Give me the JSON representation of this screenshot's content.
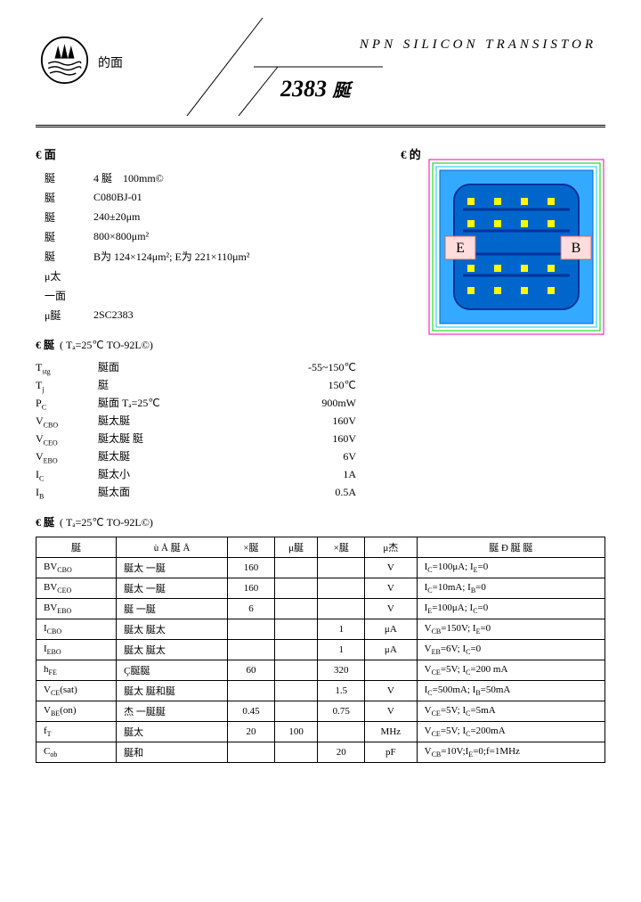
{
  "header": {
    "title": "NPN  SILICON  TRANSISTOR",
    "code": "2383",
    "code_suffix": "脠",
    "brand": "的面"
  },
  "sec1_title": "€  面",
  "sec2_title": "€  的",
  "specs": {
    "r0_lbl": "脠",
    "r0_val_a": "4 脠",
    "r0_val_b": "100mm©",
    "r1_lbl": "脠",
    "r1_val": "C080BJ-01",
    "r2_lbl": "脠",
    "r2_val": "240±20μm",
    "r3_lbl": "脠",
    "r3_val": "800×800μm²",
    "r4_lbl": "脠",
    "r4_val": "B为 124×124μm²; E为 221×110μm²",
    "r5_lbl": "μ太",
    "r6_lbl": "一面",
    "r7_lbl": "μ脠",
    "r7_val": "2SC2383"
  },
  "die_labels": {
    "e": "E",
    "b": "B"
  },
  "ratings": {
    "hdr_pre": "€  脠",
    "hdr_cond": "( Tₐ=25℃  TO-92L©)",
    "rows": [
      {
        "sym": "T_stg",
        "sym_sub": "stg",
        "sym_pre": "T",
        "mid": "脠面",
        "val": "-55~150℃"
      },
      {
        "sym_pre": "T",
        "sym_sub": "j",
        "mid": "脡",
        "val": "150℃"
      },
      {
        "sym_pre": "P",
        "sym_sub": "C",
        "mid": "脠面     Tₐ=25℃",
        "val": "900mW"
      },
      {
        "sym_pre": "V",
        "sym_sub": "CBO",
        "mid": "脠太脠",
        "val": "160V"
      },
      {
        "sym_pre": "V",
        "sym_sub": "CEO",
        "mid": "脠太脠     脡",
        "val": "160V"
      },
      {
        "sym_pre": "V",
        "sym_sub": "EBO",
        "mid": "脠太脠",
        "val": "6V"
      },
      {
        "sym_pre": "I",
        "sym_sub": "C",
        "mid": "脠太小",
        "val": "1A"
      },
      {
        "sym_pre": "I",
        "sym_sub": "B",
        "mid": "脠太面",
        "val": "0.5A"
      }
    ]
  },
  "elec": {
    "hdr_pre": "€  脠",
    "hdr_cond": "( Tₐ=25℃  TO-92L©)",
    "cols": [
      "脠",
      "ù  Å  脠  Å",
      "×脠",
      "μ脠",
      "×脠",
      "μ杰",
      "脠  Ð  脠  脠"
    ],
    "rows": [
      {
        "c0_pre": "BV",
        "c0_sub": "CBO",
        "c1": "脠太  一脠",
        "min": "160",
        "typ": "",
        "max": "",
        "unit": "V",
        "cond": "I_C=100μA; I_E=0"
      },
      {
        "c0_pre": "BV",
        "c0_sub": "CEO",
        "c1": "脠太  一脠",
        "min": "160",
        "typ": "",
        "max": "",
        "unit": "V",
        "cond": "I_C=10mA; I_B=0"
      },
      {
        "c0_pre": "BV",
        "c0_sub": "EBO",
        "c1": "脠  一脠",
        "min": "6",
        "typ": "",
        "max": "",
        "unit": "V",
        "cond": "I_E=100μA; I_C=0"
      },
      {
        "c0_pre": "I",
        "c0_sub": "CBO",
        "c1": "脠太  脠太",
        "min": "",
        "typ": "",
        "max": "1",
        "unit": "μA",
        "cond": "V_CB=150V; I_E=0"
      },
      {
        "c0_pre": "I",
        "c0_sub": "EBO",
        "c1": "脠太  脠太",
        "min": "",
        "typ": "",
        "max": "1",
        "unit": "μA",
        "cond": "V_EB=6V; I_C=0"
      },
      {
        "c0_pre": "h",
        "c0_sub": "FE",
        "c1": "Ç脠脠",
        "min": "60",
        "typ": "",
        "max": "320",
        "unit": "",
        "cond": "V_CE=5V; I_C=200 mA"
      },
      {
        "c0_pre": "V",
        "c0_sub": "CE",
        "c0_suf": "(sat)",
        "c1": "脠太  脠和脠",
        "min": "",
        "typ": "",
        "max": "1.5",
        "unit": "V",
        "cond": "I_C=500mA; I_B=50mA"
      },
      {
        "c0_pre": "V",
        "c0_sub": "BE",
        "c0_suf": "(on)",
        "c1": "杰  一脠脠",
        "min": "0.45",
        "typ": "",
        "max": "0.75",
        "unit": "V",
        "cond": "V_CE=5V; I_C=5mA"
      },
      {
        "c0_pre": "f",
        "c0_sub": "T",
        "c1": "脠太",
        "min": "20",
        "typ": "100",
        "max": "",
        "unit": "MHz",
        "cond": "V_CE=5V; I_C=200mA"
      },
      {
        "c0_pre": "C",
        "c0_sub": "ob",
        "c1": "脠和",
        "min": "",
        "typ": "",
        "max": "20",
        "unit": "pF",
        "cond": "V_CB=10V;I_E=0;f=1MHz"
      }
    ]
  }
}
